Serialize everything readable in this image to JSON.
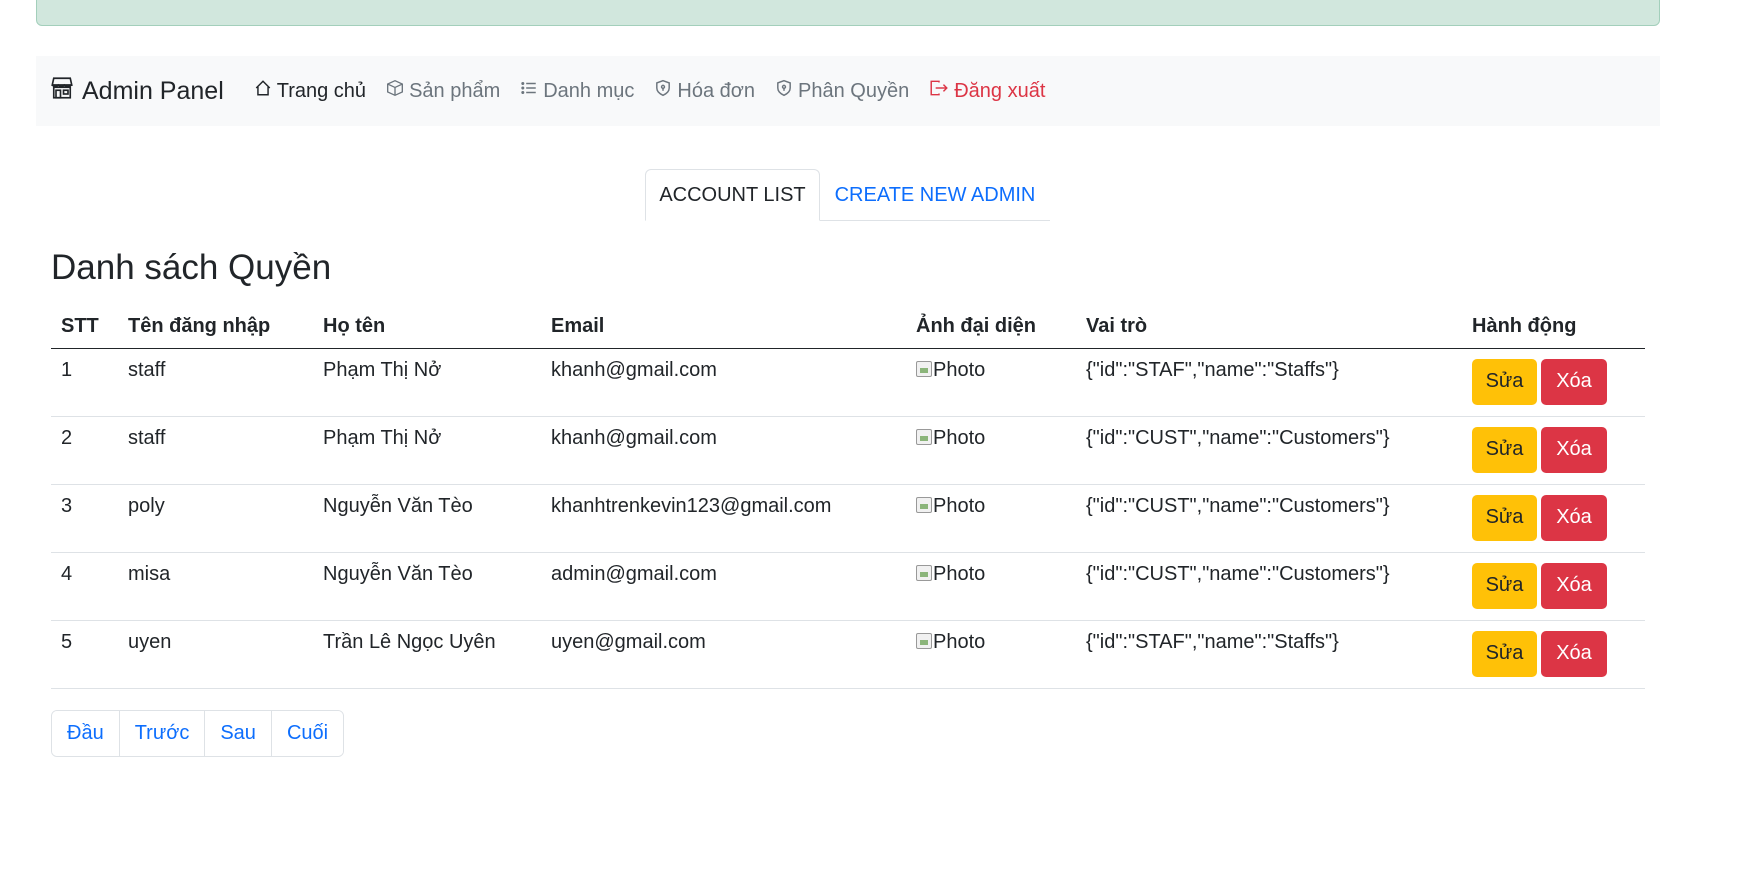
{
  "navbar": {
    "brand": "Admin Panel",
    "items": [
      {
        "label": "Trang chủ",
        "icon": "house-icon"
      },
      {
        "label": "Sản phẩm",
        "icon": "box-icon"
      },
      {
        "label": "Danh mục",
        "icon": "list-icon"
      },
      {
        "label": "Hóa đơn",
        "icon": "shield-icon"
      },
      {
        "label": "Phân Quyền",
        "icon": "shield-icon"
      },
      {
        "label": "Đăng xuất",
        "icon": "logout-icon"
      }
    ]
  },
  "tabs": [
    "ACCOUNT LIST",
    "CREATE NEW ADMIN"
  ],
  "page_title": "Danh sách Quyền",
  "table": {
    "headers": [
      "STT",
      "Tên đăng nhập",
      "Họ tên",
      "Email",
      "Ảnh đại diện",
      "Vai trò",
      "Hành động"
    ],
    "rows": [
      {
        "stt": "1",
        "username": "staff",
        "fullname": "Phạm Thị Nở",
        "email": "khanh@gmail.com",
        "photo": "Photo",
        "role": "{\"id\":\"STAF\",\"name\":\"Staffs\"}"
      },
      {
        "stt": "2",
        "username": "staff",
        "fullname": "Phạm Thị Nở",
        "email": "khanh@gmail.com",
        "photo": "Photo",
        "role": "{\"id\":\"CUST\",\"name\":\"Customers\"}"
      },
      {
        "stt": "3",
        "username": "poly",
        "fullname": "Nguyễn Văn Tèo",
        "email": "khanhtrenkevin123@gmail.com",
        "photo": "Photo",
        "role": "{\"id\":\"CUST\",\"name\":\"Customers\"}"
      },
      {
        "stt": "4",
        "username": "misa",
        "fullname": "Nguyễn Văn Tèo",
        "email": "admin@gmail.com",
        "photo": "Photo",
        "role": "{\"id\":\"CUST\",\"name\":\"Customers\"}"
      },
      {
        "stt": "5",
        "username": "uyen",
        "fullname": "Trần Lê Ngọc Uyên",
        "email": "uyen@gmail.com",
        "photo": "Photo",
        "role": "{\"id\":\"STAF\",\"name\":\"Staffs\"}"
      }
    ],
    "edit_label": "Sửa",
    "delete_label": "Xóa"
  },
  "pagination": [
    "Đầu",
    "Trước",
    "Sau",
    "Cuối"
  ],
  "colors": {
    "primary": "#0d6efd",
    "warning": "#ffc107",
    "danger": "#dc3545",
    "alert_bg": "#d1e7dd",
    "navbar_bg": "#f8f9fa"
  }
}
